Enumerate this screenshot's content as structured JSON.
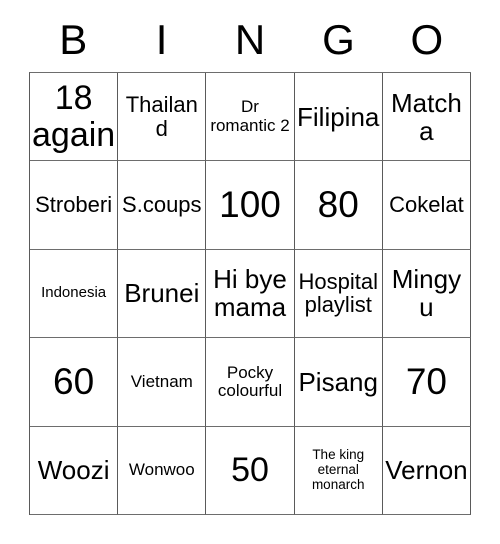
{
  "card": {
    "title_letters": [
      "B",
      "I",
      "N",
      "G",
      "O"
    ],
    "columns": 5,
    "rows": 5,
    "border_color": "#5a5a5a",
    "cell_background": "#ffffff",
    "text_color": "#000000",
    "cells": [
      [
        {
          "text": "18 again",
          "size": "xl"
        },
        {
          "text": "Thailand",
          "size": "md"
        },
        {
          "text": "Dr romantic 2",
          "size": "sm"
        },
        {
          "text": "Filipina",
          "size": "lg"
        },
        {
          "text": "Matcha",
          "size": "lg"
        }
      ],
      [
        {
          "text": "Stroberi",
          "size": "md"
        },
        {
          "text": "S.coups",
          "size": "md"
        },
        {
          "text": "100",
          "size": "xxl"
        },
        {
          "text": "80",
          "size": "xxl"
        },
        {
          "text": "Cokelat",
          "size": "md"
        }
      ],
      [
        {
          "text": "Indonesia",
          "size": "xs"
        },
        {
          "text": "Brunei",
          "size": "lg"
        },
        {
          "text": "Hi bye mama",
          "size": "lg"
        },
        {
          "text": "Hospital playlist",
          "size": "md"
        },
        {
          "text": "Mingyu",
          "size": "lg"
        }
      ],
      [
        {
          "text": "60",
          "size": "xxl"
        },
        {
          "text": "Vietnam",
          "size": "sm"
        },
        {
          "text": "Pocky colourful",
          "size": "sm"
        },
        {
          "text": "Pisang",
          "size": "lg"
        },
        {
          "text": "70",
          "size": "xxl"
        }
      ],
      [
        {
          "text": "Woozi",
          "size": "lg"
        },
        {
          "text": "Wonwoo",
          "size": "sm"
        },
        {
          "text": "50",
          "size": "xl"
        },
        {
          "text": "The king eternal monarch",
          "size": "xxs"
        },
        {
          "text": "Vernon",
          "size": "lg"
        }
      ]
    ]
  }
}
